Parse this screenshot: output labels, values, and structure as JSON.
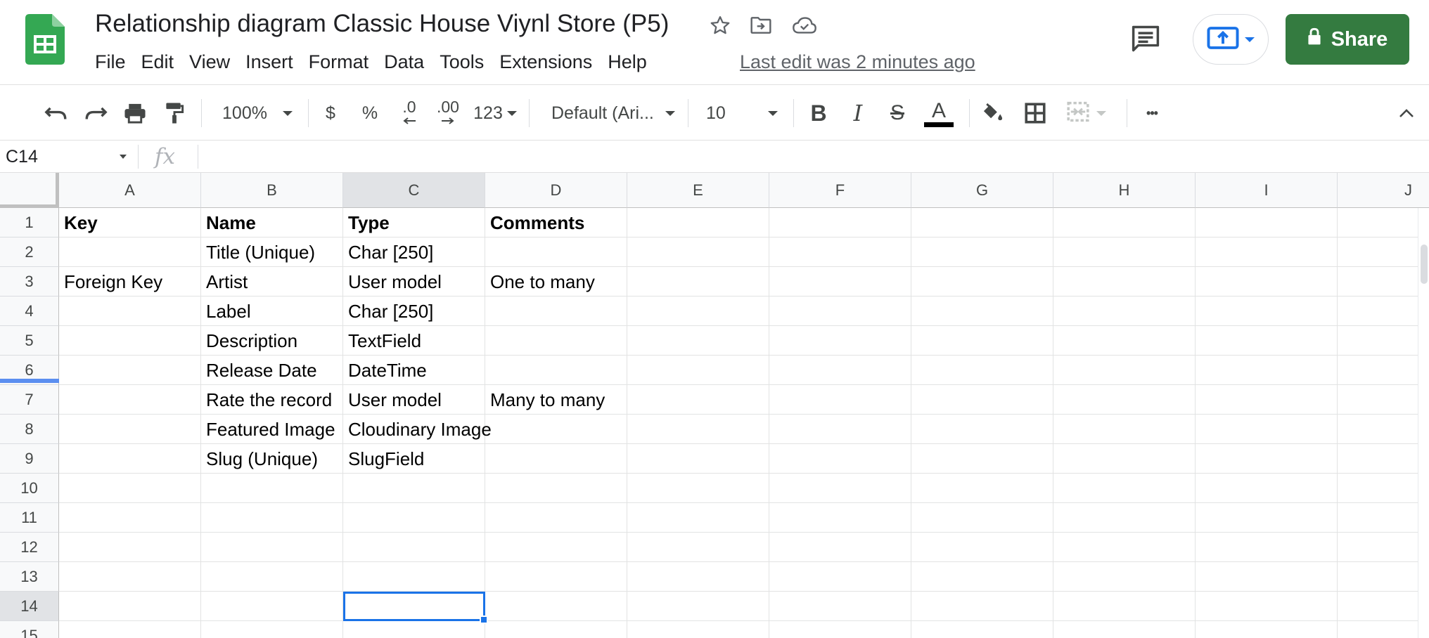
{
  "app": {
    "doc_title": "Relationship diagram Classic House Viynl Store (P5)",
    "last_edit": "Last edit was 2 minutes ago",
    "share_label": "Share",
    "menu": [
      "File",
      "Edit",
      "View",
      "Insert",
      "Format",
      "Data",
      "Tools",
      "Extensions",
      "Help"
    ]
  },
  "toolbar": {
    "zoom": "100%",
    "currency": "$",
    "percent": "%",
    "decrease_decimals": ".0",
    "increase_decimals": ".00",
    "more_formats": "123",
    "font": "Default (Ari...",
    "font_size": "10",
    "bold": "B",
    "italic": "I",
    "strikethrough": "S",
    "text_color": "A",
    "more": "•••"
  },
  "formula_bar": {
    "name_box": "C14",
    "fx": "fx",
    "value": ""
  },
  "sheet": {
    "columns": [
      "A",
      "B",
      "C",
      "D",
      "E",
      "F",
      "G",
      "H",
      "I",
      "J"
    ],
    "rows": [
      "1",
      "2",
      "3",
      "4",
      "5",
      "6",
      "7",
      "8",
      "9",
      "10",
      "11",
      "12",
      "13",
      "14",
      "15"
    ],
    "cells": [
      [
        "Key",
        "Name",
        "Type",
        "Comments",
        "",
        "",
        "",
        "",
        "",
        ""
      ],
      [
        "",
        "Title (Unique)",
        "Char [250]",
        "",
        "",
        "",
        "",
        "",
        "",
        ""
      ],
      [
        "Foreign Key",
        "Artist",
        "User model",
        "One to many",
        "",
        "",
        "",
        "",
        "",
        ""
      ],
      [
        "",
        "Label",
        "Char [250]",
        "",
        "",
        "",
        "",
        "",
        "",
        ""
      ],
      [
        "",
        "Description",
        "TextField",
        "",
        "",
        "",
        "",
        "",
        "",
        ""
      ],
      [
        "",
        "Release Date",
        "DateTime",
        "",
        "",
        "",
        "",
        "",
        "",
        ""
      ],
      [
        "",
        "Rate the record",
        "User model",
        "Many to many",
        "",
        "",
        "",
        "",
        "",
        ""
      ],
      [
        "",
        "Featured Image",
        "Cloudinary Image",
        "",
        "",
        "",
        "",
        "",
        "",
        ""
      ],
      [
        "",
        "Slug (Unique)",
        "SlugField",
        "",
        "",
        "",
        "",
        "",
        "",
        ""
      ],
      [
        "",
        "",
        "",
        "",
        "",
        "",
        "",
        "",
        "",
        ""
      ],
      [
        "",
        "",
        "",
        "",
        "",
        "",
        "",
        "",
        "",
        ""
      ],
      [
        "",
        "",
        "",
        "",
        "",
        "",
        "",
        "",
        "",
        ""
      ],
      [
        "",
        "",
        "",
        "",
        "",
        "",
        "",
        "",
        "",
        ""
      ],
      [
        "",
        "",
        "",
        "",
        "",
        "",
        "",
        "",
        "",
        ""
      ],
      [
        "",
        "",
        "",
        "",
        "",
        "",
        "",
        "",
        "",
        ""
      ]
    ],
    "selected_cell": "C14",
    "accent_color": "#1a73e8",
    "share_color": "#347b40"
  }
}
